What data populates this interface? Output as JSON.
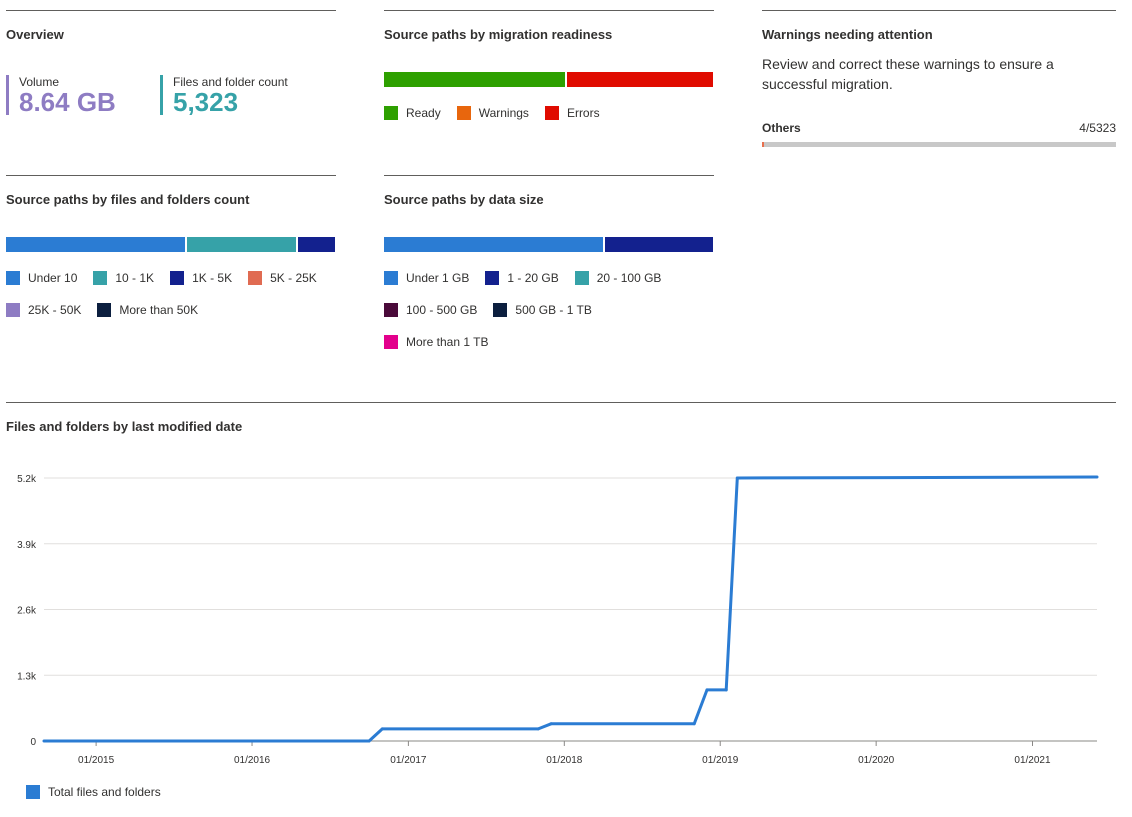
{
  "overview": {
    "title": "Overview",
    "volume": {
      "label": "Volume",
      "value": "8.64 GB",
      "color": "#8e7cc3"
    },
    "files": {
      "label": "Files and folder count",
      "value": "5,323",
      "color": "#36a2a8"
    }
  },
  "readiness": {
    "title": "Source paths by migration readiness",
    "segments": [
      {
        "name": "Ready",
        "color": "#2ea000",
        "share": 0.555
      },
      {
        "name": "Errors",
        "color": "#e00b00",
        "share": 0.445
      }
    ],
    "legend": [
      {
        "label": "Ready",
        "color": "#2ea000"
      },
      {
        "label": "Warnings",
        "color": "#e8660d"
      },
      {
        "label": "Errors",
        "color": "#e00b00"
      }
    ]
  },
  "warnings": {
    "title": "Warnings needing attention",
    "description": "Review and correct these warnings to ensure a successful migration.",
    "items": [
      {
        "name": "Others",
        "count": "4/5323",
        "fraction": 0.00075
      }
    ]
  },
  "files_count": {
    "title": "Source paths by files and folders count",
    "segments": [
      {
        "name": "Under 10",
        "color": "#2b7cd3",
        "share": 0.55
      },
      {
        "name": "10 - 1K",
        "color": "#36a2a8",
        "share": 0.335
      },
      {
        "name": "1K - 5K",
        "color": "#13218e",
        "share": 0.115
      }
    ],
    "legend": [
      [
        {
          "label": "Under 10",
          "color": "#2b7cd3"
        },
        {
          "label": "10 - 1K",
          "color": "#36a2a8"
        },
        {
          "label": "1K - 5K",
          "color": "#13218e"
        },
        {
          "label": "5K - 25K",
          "color": "#e06b52"
        }
      ],
      [
        {
          "label": "25K - 50K",
          "color": "#8e7cc3"
        },
        {
          "label": "More than 50K",
          "color": "#0c1f3f"
        }
      ]
    ]
  },
  "data_size": {
    "title": "Source paths by data size",
    "segments": [
      {
        "name": "Under 1 GB",
        "color": "#2b7cd3",
        "share": 0.67
      },
      {
        "name": "1 - 20 GB",
        "color": "#13218e",
        "share": 0.33
      }
    ],
    "legend": [
      [
        {
          "label": "Under 1 GB",
          "color": "#2b7cd3"
        },
        {
          "label": "1 - 20 GB",
          "color": "#13218e"
        },
        {
          "label": "20 - 100 GB",
          "color": "#36a2a8"
        }
      ],
      [
        {
          "label": "100 - 500 GB",
          "color": "#4a0a3a"
        },
        {
          "label": "500 GB - 1 TB",
          "color": "#0c1f3f"
        }
      ],
      [
        {
          "label": "More than 1 TB",
          "color": "#e3008c"
        }
      ]
    ]
  },
  "modified": {
    "title": "Files and folders by last modified date"
  },
  "chart_data": {
    "type": "line",
    "title": "Files and folders by last modified date",
    "xlabel": "",
    "ylabel": "",
    "x_ticks": [
      "01/2015",
      "01/2016",
      "01/2017",
      "01/2018",
      "01/2019",
      "01/2020",
      "01/2021"
    ],
    "y_ticks": [
      "0",
      "1.3k",
      "2.6k",
      "3.9k",
      "5.2k"
    ],
    "y_tick_values": [
      0,
      1300,
      2600,
      3900,
      5200
    ],
    "xlim": [
      "2014-09-01",
      "2021-06-01"
    ],
    "ylim": [
      0,
      5200
    ],
    "grid": true,
    "legend_position": "bottom-left",
    "series": [
      {
        "name": "Total files and folders",
        "color": "#2b7cd3",
        "x": [
          "2014-09-01",
          "2016-10-01",
          "2016-11-01",
          "2017-11-01",
          "2017-12-01",
          "2018-11-01",
          "2018-12-01",
          "2019-01-15",
          "2019-02-10",
          "2021-06-01"
        ],
        "y": [
          0,
          0,
          240,
          240,
          340,
          340,
          1010,
          1010,
          5200,
          5220
        ]
      }
    ]
  }
}
